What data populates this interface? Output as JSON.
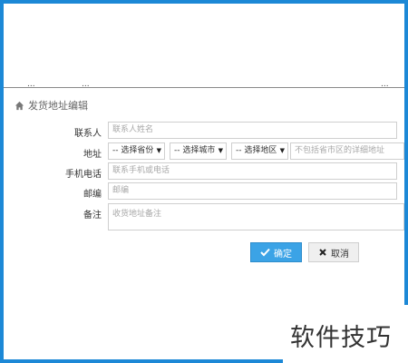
{
  "section": {
    "title": "发货地址编辑"
  },
  "top_clipped": {
    "left_text": "...",
    "mid_text": "...",
    "right_text": "..."
  },
  "form": {
    "contact": {
      "label": "联系人",
      "placeholder": "联系人姓名"
    },
    "address": {
      "label": "地址",
      "province": "-- 选择省份",
      "city": "-- 选择城市",
      "district": "-- 选择地区",
      "detail_placeholder": "不包括省市区的详细地址"
    },
    "phone": {
      "label": "手机电话",
      "placeholder": "联系手机或电话"
    },
    "zip": {
      "label": "邮编",
      "placeholder": "邮编"
    },
    "note": {
      "label": "备注",
      "placeholder": "收货地址备注"
    }
  },
  "buttons": {
    "confirm": "确定",
    "cancel": "取消"
  },
  "watermark": "软件技巧",
  "colors": {
    "frame": "#1c88d6",
    "primary": "#3ba3e6"
  }
}
